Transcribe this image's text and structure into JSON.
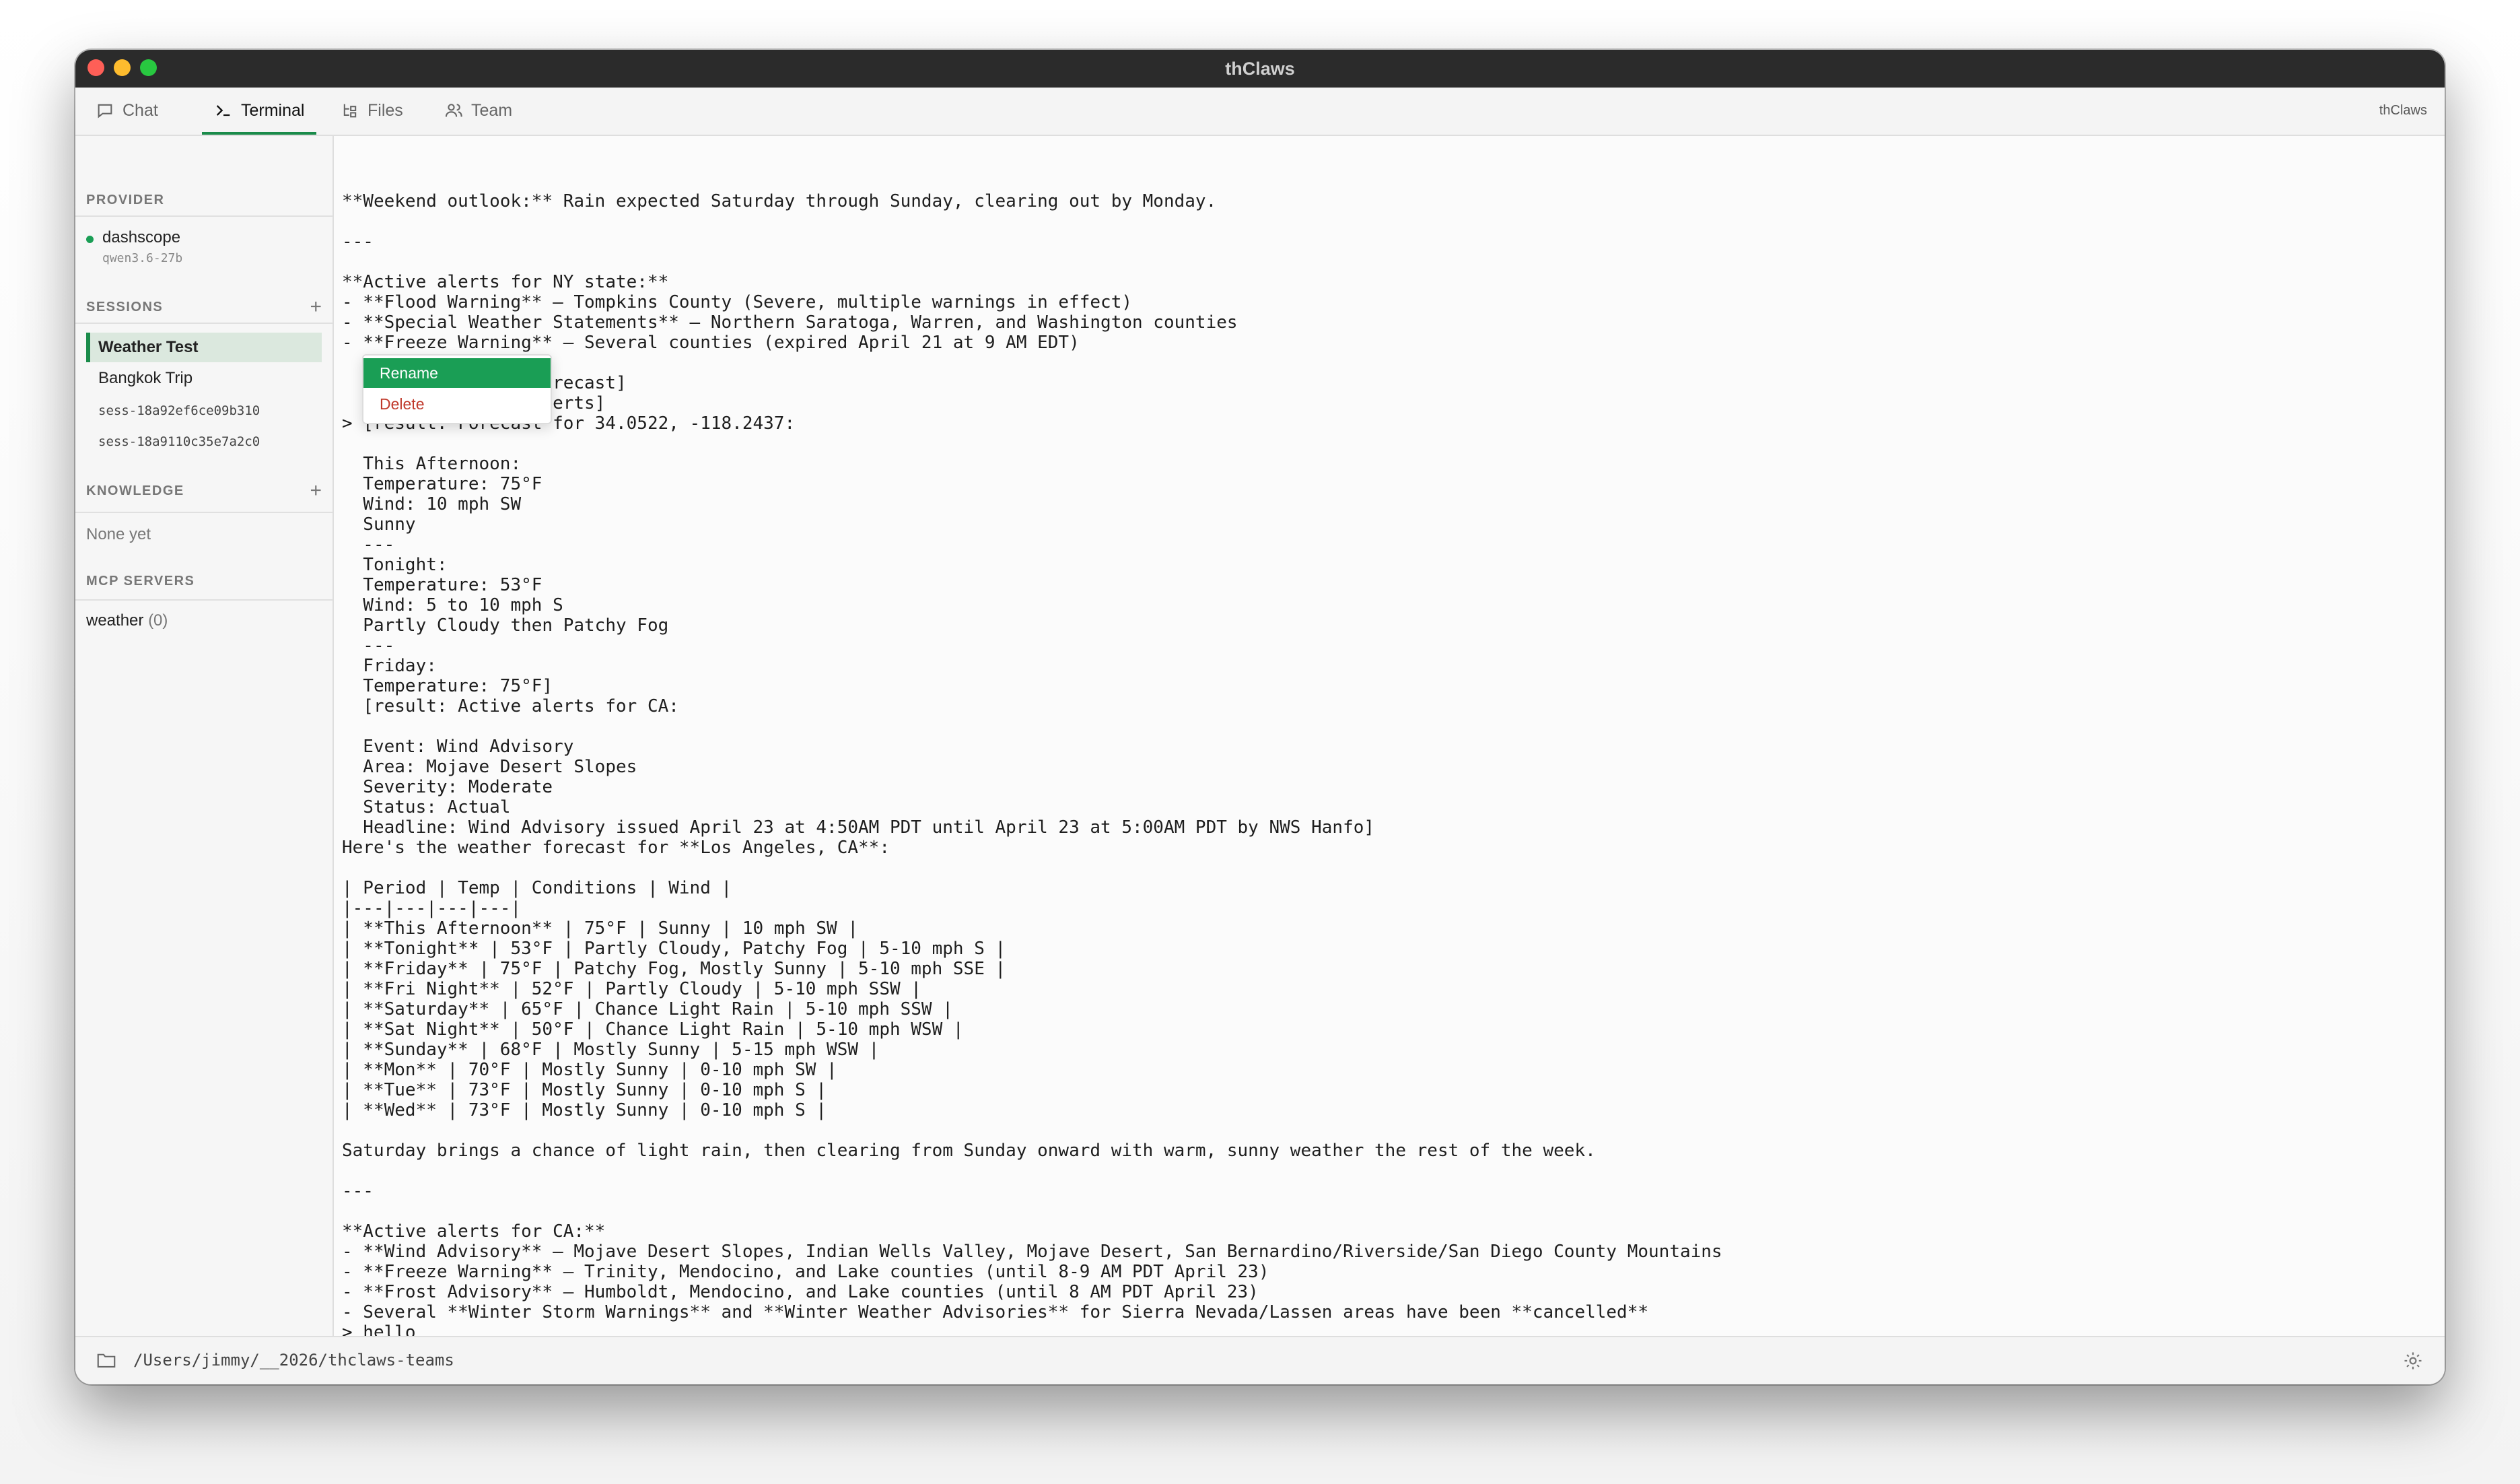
{
  "window": {
    "title": "thClaws"
  },
  "tabs": [
    {
      "label": "Chat",
      "icon": "chat-bubble-icon"
    },
    {
      "label": "Terminal",
      "icon": "terminal-prompt-icon",
      "active": true
    },
    {
      "label": "Files",
      "icon": "file-tree-icon"
    },
    {
      "label": "Team",
      "icon": "team-icon"
    }
  ],
  "brand": "thClaws",
  "sidebar": {
    "provider": {
      "header": "PROVIDER",
      "name": "dashscope",
      "model": "qwen3.6-27b",
      "status_color": "#1a9e55"
    },
    "sessions": {
      "header": "SESSIONS",
      "add_label": "+",
      "items": [
        {
          "label": "Weather Test",
          "active": true
        },
        {
          "label": "Bangkok Trip"
        },
        {
          "label": "sess-18a92ef6ce09b310"
        },
        {
          "label": "sess-18a9110c35e7a2c0"
        }
      ]
    },
    "knowledge": {
      "header": "KNOWLEDGE",
      "add_label": "+",
      "empty_text": "None yet"
    },
    "mcp": {
      "header": "MCP SERVERS",
      "items": [
        {
          "name": "weather",
          "count": "(0)"
        }
      ]
    }
  },
  "context_menu": {
    "items": [
      {
        "label": "Rename"
      },
      {
        "label": "Delete"
      }
    ]
  },
  "terminal": {
    "lines": [
      "**Weekend outlook:** Rain expected Saturday through Sunday, clearing out by Monday.",
      "",
      "---",
      "",
      "**Active alerts for NY state:**",
      "- **Flood Warning** — Tompkins County (Severe, multiple warnings in effect)",
      "- **Special Weather Statements** — Northern Saratoga, Warren, and Washington counties",
      "- **Freeze Warning** — Several counties (expired April 21 at 9 AM EDT)",
      "            of CA",
      "          er__get-forecast]",
      "          er__get-alerts]",
      "> [result: Forecast for 34.0522, -118.2437:",
      "",
      "  This Afternoon:",
      "  Temperature: 75°F",
      "  Wind: 10 mph SW",
      "  Sunny",
      "  ---",
      "  Tonight:",
      "  Temperature: 53°F",
      "  Wind: 5 to 10 mph S",
      "  Partly Cloudy then Patchy Fog",
      "  ---",
      "  Friday:",
      "  Temperature: 75°F]",
      "  [result: Active alerts for CA:",
      "",
      "  Event: Wind Advisory",
      "  Area: Mojave Desert Slopes",
      "  Severity: Moderate",
      "  Status: Actual",
      "  Headline: Wind Advisory issued April 23 at 4:50AM PDT until April 23 at 5:00AM PDT by NWS Hanfo]",
      "Here's the weather forecast for **Los Angeles, CA**:",
      "",
      "| Period | Temp | Conditions | Wind |",
      "|---|---|---|---|",
      "| **This Afternoon** | 75°F | Sunny | 10 mph SW |",
      "| **Tonight** | 53°F | Partly Cloudy, Patchy Fog | 5-10 mph S |",
      "| **Friday** | 75°F | Patchy Fog, Mostly Sunny | 5-10 mph SSE |",
      "| **Fri Night** | 52°F | Partly Cloudy | 5-10 mph SSW |",
      "| **Saturday** | 65°F | Chance Light Rain | 5-10 mph SSW |",
      "| **Sat Night** | 50°F | Chance Light Rain | 5-10 mph WSW |",
      "| **Sunday** | 68°F | Mostly Sunny | 5-15 mph WSW |",
      "| **Mon** | 70°F | Mostly Sunny | 0-10 mph SW |",
      "| **Tue** | 73°F | Mostly Sunny | 0-10 mph S |",
      "| **Wed** | 73°F | Mostly Sunny | 0-10 mph S |",
      "",
      "Saturday brings a chance of light rain, then clearing from Sunday onward with warm, sunny weather the rest of the week.",
      "",
      "---",
      "",
      "**Active alerts for CA:**",
      "- **Wind Advisory** — Mojave Desert Slopes, Indian Wells Valley, Mojave Desert, San Bernardino/Riverside/San Diego County Mountains",
      "- **Freeze Warning** — Trinity, Mendocino, and Lake counties (until 8-9 AM PDT April 23)",
      "- **Frost Advisory** — Humboldt, Mendocino, and Lake counties (until 8 AM PDT April 23)",
      "- Several **Winter Storm Warnings** and **Winter Weather Advisories** for Sierra Nevada/Lassen areas have been **cancelled**",
      "> hello",
      "Hey! How can I help you today?"
    ],
    "prompt_char": "❯"
  },
  "statusbar": {
    "path": "/Users/jimmy/__2026/thclaws-teams"
  }
}
